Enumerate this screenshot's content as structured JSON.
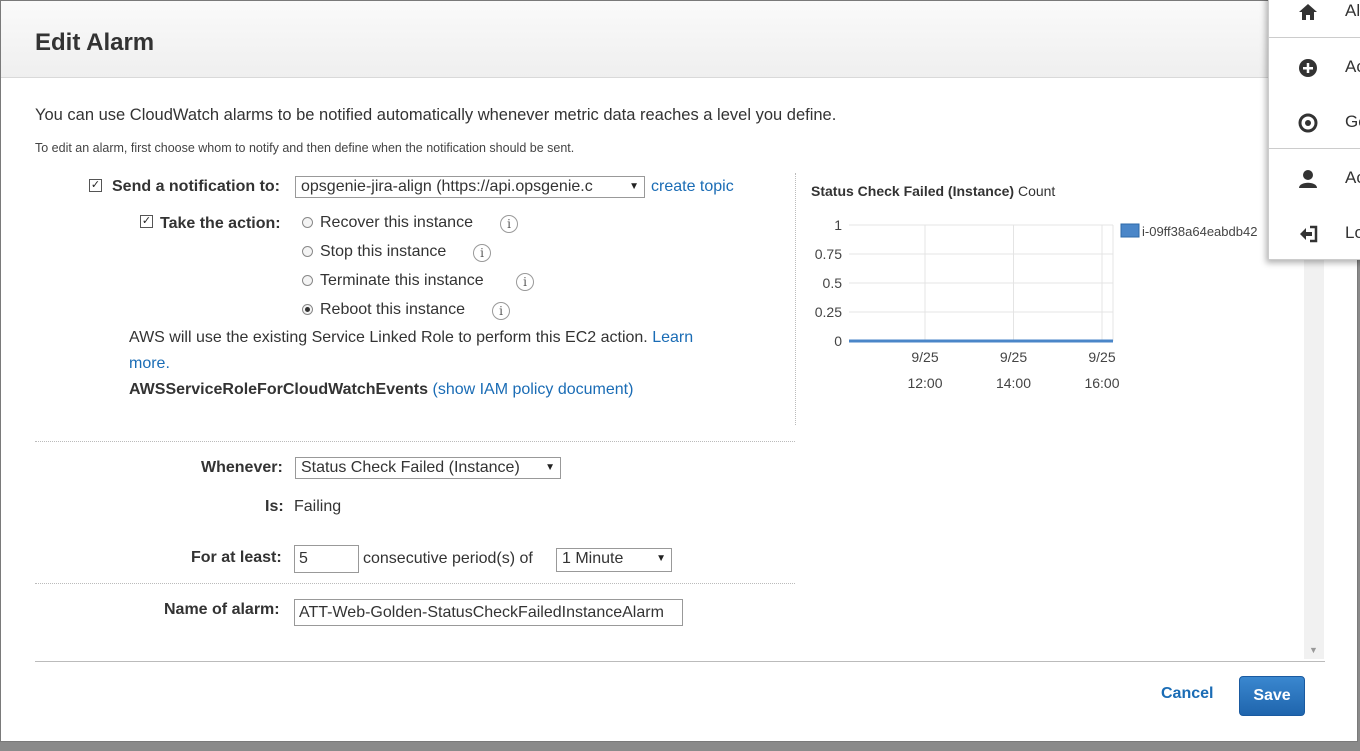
{
  "header": {
    "title": "Edit Alarm"
  },
  "intro": {
    "main": "You can use CloudWatch alarms to be notified automatically whenever metric data reaches a level you define.",
    "sub": "To edit an alarm, first choose whom to notify and then define when the notification should be sent."
  },
  "notification": {
    "label": "Send a notification to:",
    "checked": true,
    "topic_value": "opsgenie-jira-align (https://api.opsgenie.c",
    "create_topic": "create topic"
  },
  "action": {
    "label": "Take the action:",
    "checked": true,
    "options": [
      {
        "label": "Recover this instance",
        "selected": false
      },
      {
        "label": "Stop this instance",
        "selected": false
      },
      {
        "label": "Terminate this instance",
        "selected": false
      },
      {
        "label": "Reboot this instance",
        "selected": true
      }
    ],
    "role_note": "AWS will use the existing Service Linked Role to perform this EC2 action.",
    "learn": "Learn",
    "more": "more.",
    "role_name": "AWSServiceRoleForCloudWatchEvents",
    "show_policy": "(show IAM policy document)"
  },
  "condition": {
    "whenever_label": "Whenever:",
    "whenever_value": "Status Check Failed (Instance)",
    "is_label": "Is:",
    "is_value": "Failing",
    "for_label": "For at least:",
    "periods_value": "5",
    "periods_text": "consecutive period(s) of",
    "period_value": "1 Minute",
    "name_label": "Name of alarm:",
    "name_value": "ATT-Web-Golden-StatusCheckFailedInstanceAlarm"
  },
  "chart_data": {
    "type": "line",
    "title": "Status Check Failed (Instance)",
    "unit": "Count",
    "y_ticks": [
      "1",
      "0.75",
      "0.5",
      "0.25",
      "0"
    ],
    "ylim": [
      0,
      1
    ],
    "x_ticks": [
      {
        "date": "9/25",
        "time": "12:00"
      },
      {
        "date": "9/25",
        "time": "14:00"
      },
      {
        "date": "9/25",
        "time": "16:00"
      }
    ],
    "grid": true,
    "series": [
      {
        "name": "i-09ff38a64eabdb42",
        "color": "#4a86c8",
        "values": [
          0,
          0,
          0,
          0
        ]
      }
    ]
  },
  "footer": {
    "cancel": "Cancel",
    "save": "Save"
  },
  "menu": {
    "items": [
      {
        "label": "Al",
        "icon": "home-icon"
      },
      {
        "label": "Ac",
        "icon": "plus-circle-icon"
      },
      {
        "label": "Ge",
        "icon": "lifesaver-icon"
      },
      {
        "label": "Ac",
        "icon": "user-icon"
      },
      {
        "label": "Lo",
        "icon": "sign-out-icon"
      }
    ]
  },
  "colors": {
    "link": "#1a6cb5",
    "save_button": "#1f65ad",
    "series": "#4a86c8"
  }
}
